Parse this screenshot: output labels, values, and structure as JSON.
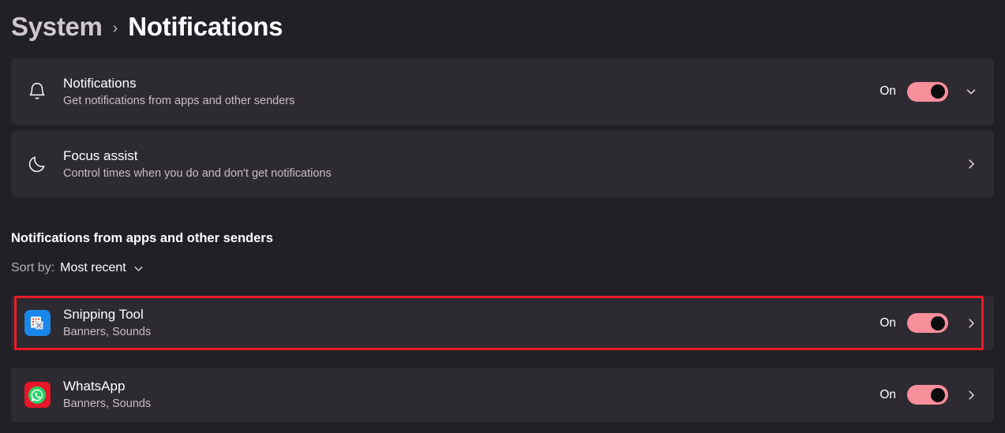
{
  "header": {
    "parent_crumb": "System",
    "separator": "›",
    "current_crumb": "Notifications"
  },
  "settings_rows": [
    {
      "icon": "bell-icon",
      "title": "Notifications",
      "subtitle": "Get notifications from apps and other senders",
      "state": "On",
      "toggle": true,
      "chevron": "chevron-down-icon"
    },
    {
      "icon": "moon-icon",
      "title": "Focus assist",
      "subtitle": "Control times when you do and don't get notifications",
      "state": "",
      "toggle": false,
      "chevron": "chevron-right-icon"
    }
  ],
  "section": {
    "title": "Notifications from apps and other senders",
    "sort_label": "Sort by:",
    "sort_value": "Most recent",
    "sort_chevron": "chevron-down-icon"
  },
  "apps": [
    {
      "icon": "snipping-tool-icon",
      "name": "Snipping Tool",
      "subtitle": "Banners, Sounds",
      "state": "On",
      "toggle": true,
      "chevron": "chevron-right-icon",
      "highlighted": true
    },
    {
      "icon": "whatsapp-icon",
      "name": "WhatsApp",
      "subtitle": "Banners, Sounds",
      "state": "On",
      "toggle": true,
      "chevron": "chevron-right-icon",
      "highlighted": false
    }
  ],
  "colors": {
    "page_background": "#222027",
    "card_background": "#2e2a32",
    "toggle_on": "#f78f9b",
    "toggle_knob": "#0d0d10",
    "annotation": "#ec1c24",
    "snipping_tile": "#1b87e8",
    "whatsapp_tile": "#e8162a",
    "whatsapp_green": "#25d366"
  }
}
